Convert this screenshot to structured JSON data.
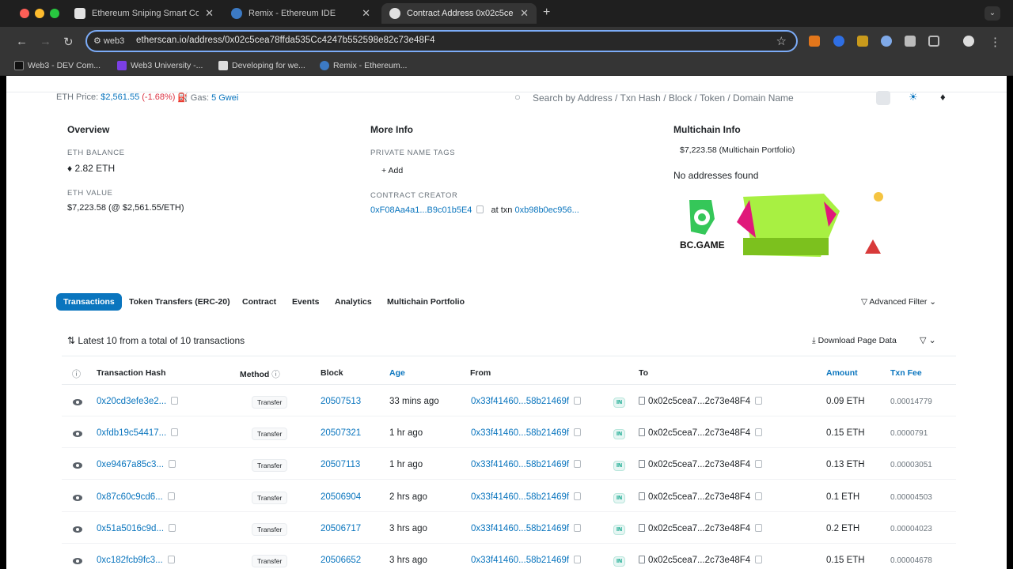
{
  "browser": {
    "tabs": [
      {
        "title": "Ethereum Sniping Smart Con",
        "active": false
      },
      {
        "title": "Remix - Ethereum IDE",
        "active": false
      },
      {
        "title": "Contract Address 0x02c5ce",
        "active": true
      }
    ],
    "omnibox": {
      "site_label": "web3",
      "url": "etherscan.io/address/0x02c5cea78ffda535Cc4247b552598e82c73e48F4"
    },
    "bookmarks": [
      "Web3 - DEV Com...",
      "Web3 University -...",
      "Developing for we...",
      "Remix - Ethereum..."
    ]
  },
  "topbar": {
    "eth_price_label": "ETH Price:",
    "eth_price": "$2,561.55",
    "eth_change": "(-1.68%)",
    "gas_label": "Gas:",
    "gas": "5 Gwei",
    "search_placeholder": "Search by Address / Txn Hash / Block / Token / Domain Name"
  },
  "overview": {
    "title": "Overview",
    "balance_label": "ETH BALANCE",
    "balance": "2.82 ETH",
    "value_label": "ETH VALUE",
    "value": "$7,223.58 (@ $2,561.55/ETH)"
  },
  "more_info": {
    "title": "More Info",
    "tags_label": "PRIVATE NAME TAGS",
    "add_label": "+ Add",
    "creator_label": "CONTRACT CREATOR",
    "creator": "0xF08Aa4a1...B9c01b5E4",
    "at_txn": "at txn",
    "txn": "0xb98b0ec956..."
  },
  "multichain": {
    "title": "Multichain Info",
    "portfolio": "$7,223.58 (Multichain Portfolio)",
    "none": "No addresses found",
    "ad_brand": "BC.GAME"
  },
  "tabs": [
    "Transactions",
    "Token Transfers (ERC-20)",
    "Contract",
    "Events",
    "Analytics",
    "Multichain Portfolio"
  ],
  "advanced_filter": "Advanced Filter",
  "summary": "Latest 10 from a total of 10 transactions",
  "download": "Download Page Data",
  "table": {
    "headers": [
      "Transaction Hash",
      "Method",
      "Block",
      "Age",
      "From",
      "To",
      "Amount",
      "Txn Fee"
    ],
    "rows": [
      {
        "hash": "0x20cd3efe3e2...",
        "method": "Transfer",
        "block": "20507513",
        "age": "33 mins ago",
        "from": "0x33f41460...58b21469f",
        "dir": "IN",
        "to": "0x02c5cea7...2c73e48F4",
        "amount": "0.09 ETH",
        "fee": "0.00014779"
      },
      {
        "hash": "0xfdb19c54417...",
        "method": "Transfer",
        "block": "20507321",
        "age": "1 hr ago",
        "from": "0x33f41460...58b21469f",
        "dir": "IN",
        "to": "0x02c5cea7...2c73e48F4",
        "amount": "0.15 ETH",
        "fee": "0.0000791"
      },
      {
        "hash": "0xe9467a85c3...",
        "method": "Transfer",
        "block": "20507113",
        "age": "1 hr ago",
        "from": "0x33f41460...58b21469f",
        "dir": "IN",
        "to": "0x02c5cea7...2c73e48F4",
        "amount": "0.13 ETH",
        "fee": "0.00003051"
      },
      {
        "hash": "0x87c60c9cd6...",
        "method": "Transfer",
        "block": "20506904",
        "age": "2 hrs ago",
        "from": "0x33f41460...58b21469f",
        "dir": "IN",
        "to": "0x02c5cea7...2c73e48F4",
        "amount": "0.1 ETH",
        "fee": "0.00004503"
      },
      {
        "hash": "0x51a5016c9d...",
        "method": "Transfer",
        "block": "20506717",
        "age": "3 hrs ago",
        "from": "0x33f41460...58b21469f",
        "dir": "IN",
        "to": "0x02c5cea7...2c73e48F4",
        "amount": "0.2 ETH",
        "fee": "0.00004023"
      },
      {
        "hash": "0xc182fcb9fc3...",
        "method": "Transfer",
        "block": "20506652",
        "age": "3 hrs ago",
        "from": "0x33f41460...58b21469f",
        "dir": "IN",
        "to": "0x02c5cea7...2c73e48F4",
        "amount": "0.15 ETH",
        "fee": "0.00004678"
      }
    ]
  }
}
